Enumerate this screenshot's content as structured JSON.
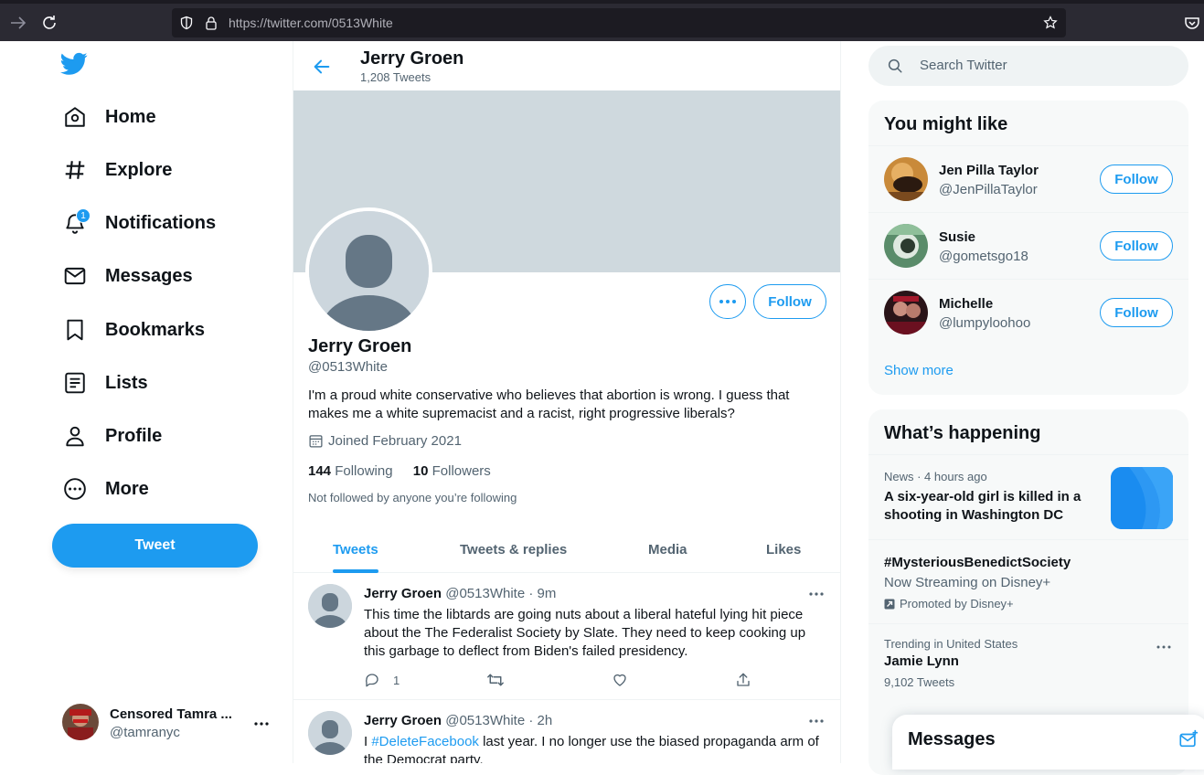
{
  "browser": {
    "url_host": "https://twitter.com/",
    "url_path": "0513White"
  },
  "nav": {
    "items": [
      {
        "label": "Home",
        "icon": "home-icon"
      },
      {
        "label": "Explore",
        "icon": "hashtag-icon"
      },
      {
        "label": "Notifications",
        "icon": "bell-icon",
        "badge": "1"
      },
      {
        "label": "Messages",
        "icon": "envelope-icon"
      },
      {
        "label": "Bookmarks",
        "icon": "bookmark-icon"
      },
      {
        "label": "Lists",
        "icon": "list-icon"
      },
      {
        "label": "Profile",
        "icon": "person-icon"
      },
      {
        "label": "More",
        "icon": "more-circle-icon"
      }
    ],
    "tweet_button": "Tweet"
  },
  "account": {
    "name": "Censored Tamra ...",
    "handle": "@tamranyc"
  },
  "header": {
    "name": "Jerry Groen",
    "tweet_count": "1,208 Tweets"
  },
  "profile": {
    "name": "Jerry Groen",
    "handle": "@0513White",
    "bio": "I'm a proud white conservative who believes that abortion is wrong.  I guess that makes me a white supremacist and a racist, right progressive liberals?",
    "joined": "Joined February 2021",
    "following_count": "144",
    "following_label": "Following",
    "followers_count": "10",
    "followers_label": "Followers",
    "not_followed": "Not followed by anyone you’re following",
    "follow_label": "Follow"
  },
  "tabs": [
    "Tweets",
    "Tweets & replies",
    "Media",
    "Likes"
  ],
  "tweets": [
    {
      "name": "Jerry Groen",
      "meta": "@0513White · 9m",
      "text": "This time the libtards are going nuts about a liberal hateful lying hit piece about the The Federalist Society by Slate.  They need to keep cooking up this garbage to deflect from Biden's failed presidency.",
      "replies": "1"
    },
    {
      "name": "Jerry Groen",
      "meta": "@0513White · 2h",
      "text_pre": "I ",
      "text_link": "#DeleteFacebook",
      "text_post": " last year.  I no longer use the biased propaganda arm of the Democrat party."
    }
  ],
  "search": {
    "placeholder": "Search Twitter"
  },
  "you_might_like": {
    "title": "You might like",
    "users": [
      {
        "name": "Jen Pilla Taylor",
        "handle": "@JenPillaTaylor",
        "button": "Follow"
      },
      {
        "name": "Susie",
        "handle": "@gometsgo18",
        "button": "Follow"
      },
      {
        "name": "Michelle",
        "handle": "@lumpyloohoo",
        "button": "Follow"
      }
    ],
    "show_more": "Show more"
  },
  "whats_happening": {
    "title": "What’s happening",
    "items": [
      {
        "meta": "News · 4 hours ago",
        "headline": "A six-year-old girl is killed in a shooting in Washington DC"
      },
      {
        "headline": "#MysteriousBenedictSociety",
        "sub": "Now Streaming on Disney+",
        "promoted": "Promoted by Disney+"
      },
      {
        "meta": "Trending in United States",
        "headline": "Jamie Lynn",
        "sub": "9,102 Tweets"
      }
    ]
  },
  "messages_drawer": {
    "title": "Messages"
  },
  "colors": {
    "accent": "#1d9bf0",
    "banner": "#cfd9de",
    "text": "#0f1419",
    "muted": "#536471"
  }
}
